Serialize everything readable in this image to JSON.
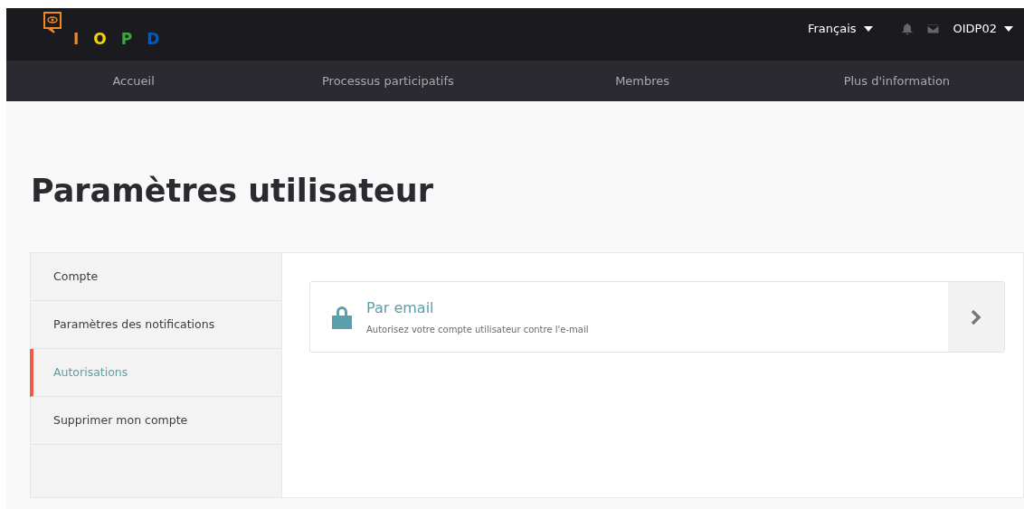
{
  "logo": {
    "letters": [
      {
        "text": "I",
        "color": "#f08a24"
      },
      {
        "text": "O",
        "color": "#f5d400"
      },
      {
        "text": "P",
        "color": "#3aa83a"
      },
      {
        "text": "D",
        "color": "#0a57b8"
      }
    ]
  },
  "header": {
    "language": "Français",
    "user": "OIDP02"
  },
  "nav": [
    {
      "label": "Accueil"
    },
    {
      "label": "Processus participatifs"
    },
    {
      "label": "Membres"
    },
    {
      "label": "Plus d'information"
    }
  ],
  "page_title": "Paramètres utilisateur",
  "sidebar": {
    "items": [
      {
        "label": "Compte",
        "selected": false
      },
      {
        "label": "Paramètres des notifications",
        "selected": false
      },
      {
        "label": "Autorisations",
        "selected": true
      },
      {
        "label": "Supprimer mon compte",
        "selected": false
      }
    ]
  },
  "authorizations": [
    {
      "title": "Par email",
      "description": "Autorisez votre compte utilisateur contre l'e-mail"
    }
  ]
}
